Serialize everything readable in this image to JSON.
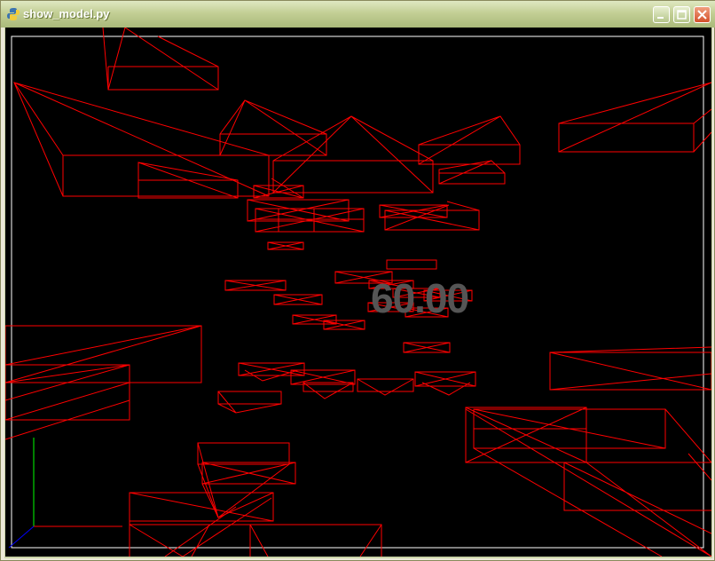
{
  "window": {
    "title": "show_model.py",
    "title_icon": "python-icon",
    "controls": {
      "minimize": "minimize-icon",
      "maximize": "maximize-icon",
      "close": "close-icon"
    }
  },
  "viewport": {
    "fps_label": "60.00",
    "background": "#000000",
    "wire_color": "#ff0000"
  }
}
